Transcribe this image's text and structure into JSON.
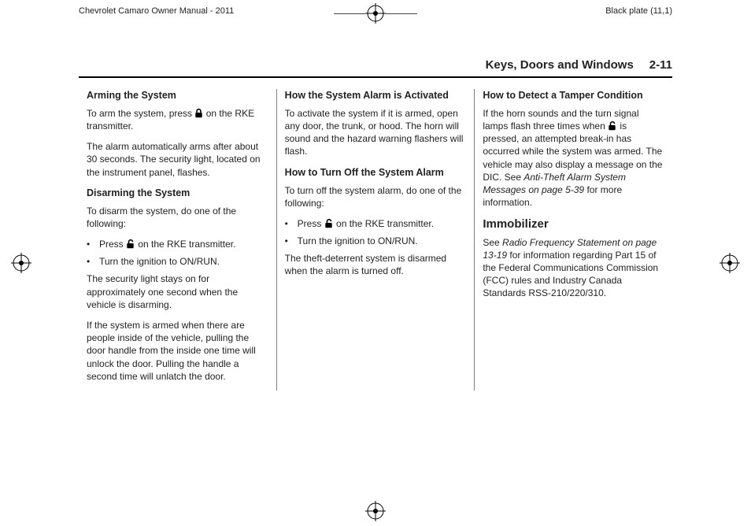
{
  "header": {
    "manual_title": "Chevrolet Camaro Owner Manual - 2011",
    "plate_label": "Black plate (11,1)"
  },
  "page": {
    "section_title": "Keys, Doors and Windows",
    "page_number": "2-11"
  },
  "col1": {
    "h_arming": "Arming the System",
    "p_arming_1a": "To arm the system, press ",
    "p_arming_1b": " on the RKE transmitter.",
    "p_arming_2": "The alarm automatically arms after about 30 seconds. The security light, located on the instrument panel, flashes.",
    "h_disarming": "Disarming the System",
    "p_disarming_intro": "To disarm the system, do one of the following:",
    "b_disarm_1a": "Press ",
    "b_disarm_1b": " on the RKE transmitter.",
    "b_disarm_2": "Turn the ignition to ON/RUN.",
    "p_disarming_2": "The security light stays on for approximately one second when the vehicle is disarming.",
    "p_disarming_3": "If the system is armed when there are people inside of the vehicle, pulling the door handle from the inside one time will unlock the door. Pulling the handle a second time will unlatch the door."
  },
  "col2": {
    "h_activated": "How the System Alarm is Activated",
    "p_activated": "To activate the system if it is armed, open any door, the trunk, or hood. The horn will sound and the hazard warning flashers will flash.",
    "h_turnoff": "How to Turn Off the System Alarm",
    "p_turnoff_intro": "To turn off the system alarm, do one of the following:",
    "b_turnoff_1a": "Press ",
    "b_turnoff_1b": " on the RKE transmitter.",
    "b_turnoff_2": "Turn the ignition to ON/RUN.",
    "p_turnoff_end": "The theft-deterrent system is disarmed when the alarm is turned off."
  },
  "col3": {
    "h_tamper": "How to Detect a Tamper Condition",
    "p_tamper_1a": "If the horn sounds and the turn signal lamps flash three times when ",
    "p_tamper_1b": " is pressed, an attempted break-in has occurred while the system was armed. The vehicle may also display a message on the DIC. See ",
    "p_tamper_ref": "Anti-Theft Alarm System Messages on page 5-39",
    "p_tamper_1c": " for more information.",
    "h_immobilizer": "Immobilizer",
    "p_immobilizer_a": "See ",
    "p_immobilizer_ref": "Radio Frequency Statement on page 13-19",
    "p_immobilizer_b": " for information regarding Part 15 of the Federal Communications Commission (FCC) rules and Industry Canada Standards RSS-210/220/310."
  },
  "bullet_char": "•"
}
